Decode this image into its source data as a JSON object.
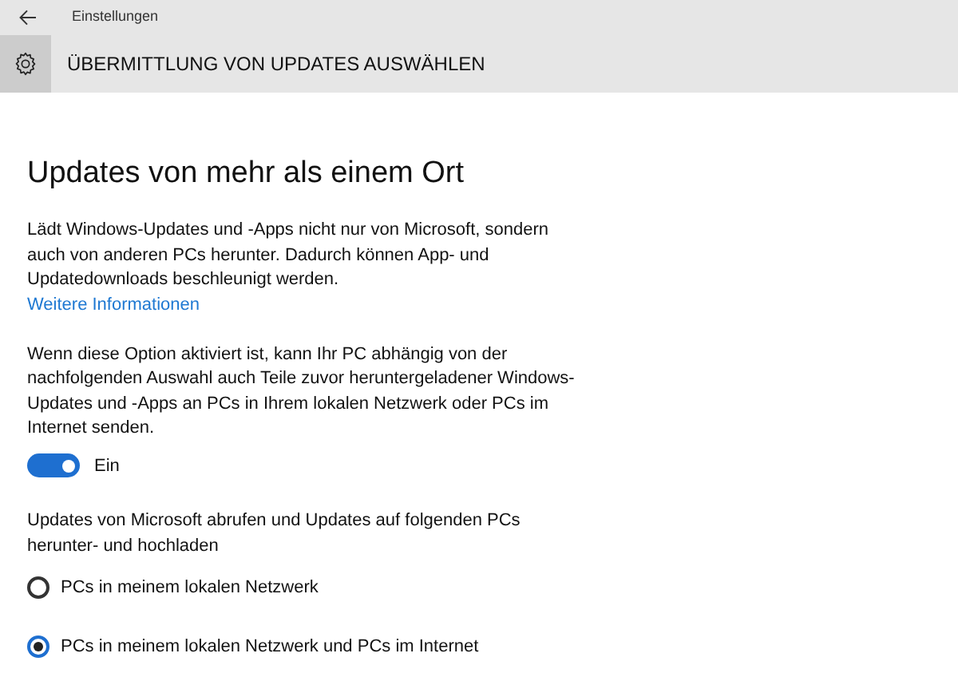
{
  "window": {
    "title": "Einstellungen"
  },
  "header": {
    "title": "ÜBERMITTLUNG VON UPDATES AUSWÄHLEN"
  },
  "section": {
    "title": "Updates von mehr als einem Ort"
  },
  "description": "Lädt Windows-Updates und -Apps nicht nur von Microsoft, sondern auch von anderen PCs herunter. Dadurch können App- und Updatedownloads beschleunigt werden.",
  "link": "Weitere Informationen",
  "option_text": "Wenn diese Option aktiviert ist, kann Ihr PC abhängig von der nachfolgenden Auswahl auch Teile zuvor heruntergeladener Windows-Updates und -Apps an PCs in Ihrem lokalen Netzwerk oder PCs im Internet senden.",
  "toggle": {
    "on": true,
    "label": "Ein"
  },
  "radio_prompt": "Updates von Microsoft abrufen und Updates auf folgenden PCs herunter- und hochladen",
  "radios": [
    {
      "label": "PCs in meinem lokalen Netzwerk",
      "selected": false
    },
    {
      "label": "PCs in meinem lokalen Netzwerk und PCs im Internet",
      "selected": true
    }
  ]
}
